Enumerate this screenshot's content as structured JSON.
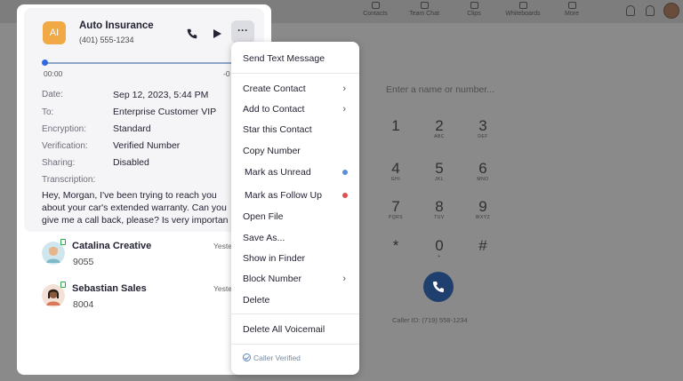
{
  "nav": {
    "items": [
      {
        "label": "Contacts"
      },
      {
        "label": "Team Chat"
      },
      {
        "label": "Clips"
      },
      {
        "label": "Whiteboards"
      },
      {
        "label": "More"
      }
    ]
  },
  "dialer": {
    "placeholder": "Enter a name or number...",
    "keys": [
      {
        "digit": "1",
        "letters": ""
      },
      {
        "digit": "2",
        "letters": "ABC"
      },
      {
        "digit": "3",
        "letters": "DEF"
      },
      {
        "digit": "4",
        "letters": "GHI"
      },
      {
        "digit": "5",
        "letters": "JKL"
      },
      {
        "digit": "6",
        "letters": "MNO"
      },
      {
        "digit": "7",
        "letters": "PQRS"
      },
      {
        "digit": "8",
        "letters": "TUV"
      },
      {
        "digit": "9",
        "letters": "WXYZ"
      },
      {
        "digit": "*",
        "letters": ""
      },
      {
        "digit": "0",
        "letters": "+"
      },
      {
        "digit": "#",
        "letters": ""
      }
    ],
    "caller_id": "Caller ID: (719) 558-1234"
  },
  "voicemail": {
    "avatar_initials": "AI",
    "name": "Auto Insurance",
    "number": "(401) 555-1234",
    "time_start": "00:00",
    "time_end": "-0",
    "details": [
      {
        "label": "Date:",
        "value": "Sep 12, 2023, 5:44 PM"
      },
      {
        "label": "To:",
        "value": "Enterprise Customer VIP"
      },
      {
        "label": "Encryption:",
        "value": "Standard"
      },
      {
        "label": "Verification:",
        "value": "Verified Number"
      },
      {
        "label": "Sharing:",
        "value": "Disabled"
      }
    ],
    "transcription_label": "Transcription:",
    "transcription_lines": [
      "Hey, Morgan, I've been trying to reach you",
      "about your car's extended warranty. Can you",
      "give me a call back, please? Is very importan"
    ],
    "more_label": "···"
  },
  "list": [
    {
      "name": "Catalina Creative",
      "ext": "9055",
      "time": "Yeste"
    },
    {
      "name": "Sebastian Sales",
      "ext": "8004",
      "time": "Yeste"
    }
  ],
  "menu": {
    "items": [
      {
        "label": "Send Text Message"
      },
      {
        "label": "Create Contact",
        "submenu": true
      },
      {
        "label": "Add to Contact",
        "submenu": true
      },
      {
        "label": "Star this Contact"
      },
      {
        "label": "Copy Number"
      },
      {
        "label": "Mark as Unread",
        "dot_color": "#5b8fd9"
      },
      {
        "label": "Mark as Follow Up",
        "dot_color": "#e05050"
      },
      {
        "label": "Open File"
      },
      {
        "label": "Save As..."
      },
      {
        "label": "Show in Finder"
      },
      {
        "label": "Block Number",
        "submenu": true
      },
      {
        "label": "Delete"
      },
      {
        "label": "Delete All Voicemail"
      }
    ],
    "verified_label": "Caller Verified"
  },
  "colors": {
    "accent": "#2d6ae3",
    "avatar_orange": "#f0a944",
    "online_green": "#2aa84a",
    "unread_dot": "#5b8fd9",
    "followup_dot": "#e05050"
  }
}
